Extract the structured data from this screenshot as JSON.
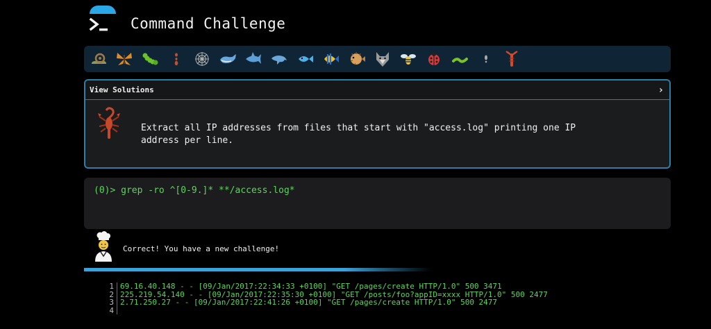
{
  "header": {
    "title": "Command Challenge",
    "logo_icon": "terminal-prompt-icon",
    "accent_color": "#2aa7e6"
  },
  "creatures": [
    {
      "name": "snail-icon",
      "color": "#7a8a55"
    },
    {
      "name": "butterfly-icon",
      "color": "#e08a2a"
    },
    {
      "name": "caterpillar-icon",
      "color": "#6cc22a"
    },
    {
      "name": "ant-icon",
      "color": "#d05c3a"
    },
    {
      "name": "spider-web-icon",
      "color": "#b0b0b0"
    },
    {
      "name": "whale-icon",
      "color": "#6aa7d8"
    },
    {
      "name": "shark-icon",
      "color": "#5d9ed6"
    },
    {
      "name": "dolphin-icon",
      "color": "#6aa7d8"
    },
    {
      "name": "fish-icon",
      "color": "#4fb0e8"
    },
    {
      "name": "tropical-fish-icon",
      "color": "#e8c02a"
    },
    {
      "name": "blowfish-icon",
      "color": "#d8a05a"
    },
    {
      "name": "wolf-icon",
      "color": "#9a9a9a"
    },
    {
      "name": "bee-icon",
      "color": "#e8c84a"
    },
    {
      "name": "ladybug-icon",
      "color": "#d83a3a"
    },
    {
      "name": "worm-icon",
      "color": "#7ac22a"
    },
    {
      "name": "bug-icon",
      "color": "#9a9a9a"
    },
    {
      "name": "lobster-icon",
      "color": "#d8482a"
    }
  ],
  "solutions": {
    "header_label": "View Solutions",
    "chevron": "›",
    "challenge_icon": "scorpion-icon",
    "challenge_text": "Extract all IP addresses from files that start with \"access.log\" printing one IP\naddress per line."
  },
  "terminal": {
    "prompt": "(0)>",
    "command": "grep -ro ^[0-9.]*  **/access.log*",
    "text_color": "#5bd65b"
  },
  "feedback": {
    "icon": "chef-icon",
    "message": "Correct! You have a new challenge!"
  },
  "output": {
    "lines": [
      {
        "n": "1",
        "text": "69.16.40.148 - - [09/Jan/2017:22:34:33 +0100] \"GET /pages/create HTTP/1.0\" 500 3471"
      },
      {
        "n": "2",
        "text": "225.219.54.140 - - [09/Jan/2017:22:35:30 +0100] \"GET /posts/foo?appID=xxxx HTTP/1.0\" 500 2477"
      },
      {
        "n": "3",
        "text": "2.71.250.27 - - [09/Jan/2017:22:41:26 +0100] \"GET /pages/create HTTP/1.0\" 500 2477"
      },
      {
        "n": "4",
        "text": ""
      }
    ]
  }
}
